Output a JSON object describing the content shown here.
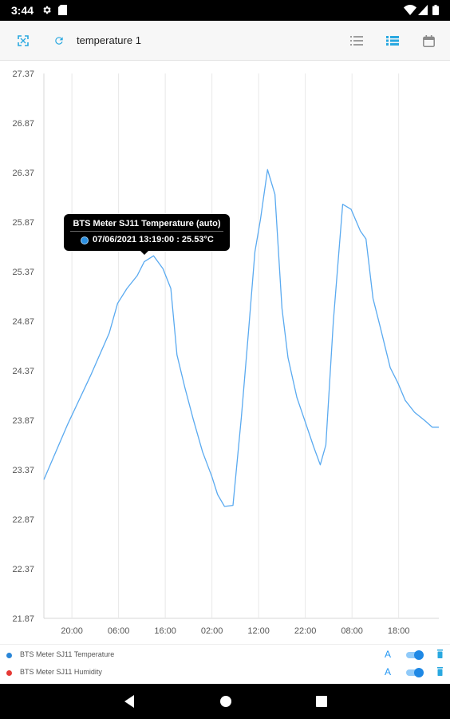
{
  "status_bar": {
    "time": "3:44",
    "icons": [
      "gear-icon",
      "sd-card-icon",
      "wifi-icon",
      "cell-signal-icon",
      "battery-icon"
    ]
  },
  "toolbar": {
    "title": "temperature 1",
    "icons": [
      "fullscreen-icon",
      "refresh-icon",
      "list-icon",
      "list-detail-icon",
      "calendar-icon"
    ],
    "accent": "#29a8e0"
  },
  "tooltip": {
    "title": "BTS Meter SJ11 Temperature (auto)",
    "value": "07/06/2021 13:19:00 : 25.53°C"
  },
  "chart_data": {
    "type": "line",
    "title": "",
    "xlabel": "",
    "ylabel": "",
    "y_ticks": [
      "27.37",
      "26.87",
      "26.37",
      "25.87",
      "25.37",
      "24.87",
      "24.37",
      "23.87",
      "23.37",
      "22.87",
      "22.37",
      "21.87"
    ],
    "ylim": [
      21.87,
      27.37
    ],
    "x_ticks": [
      "20:00",
      "06:00",
      "16:00",
      "02:00",
      "12:00",
      "22:00",
      "08:00",
      "18:00"
    ],
    "x_tick_hours": [
      6,
      16,
      26,
      36,
      46,
      56,
      66,
      76
    ],
    "xlim_hours": [
      0,
      84.6
    ],
    "grid": true,
    "series": [
      {
        "name": "BTS Meter SJ11 Temperature",
        "color": "#5aaaf0",
        "x_hours": [
          0,
          5,
          10,
          14,
          15.8,
          17.8,
          20,
          21.5,
          23.5,
          25.5,
          27.2,
          28.5,
          30.2,
          32,
          34,
          36,
          37.2,
          38.7,
          40.5,
          42.3,
          43.8,
          45.2,
          46.4,
          47.9,
          49.5,
          51,
          52.3,
          54.2,
          56,
          57.8,
          59.2,
          60.4,
          62,
          64,
          65.8,
          67.8,
          69,
          70.5,
          72.1,
          74.2,
          75.8,
          77.4,
          79.4,
          81.5,
          83.2,
          84.6
        ],
        "values": [
          23.27,
          23.82,
          24.32,
          24.75,
          25.05,
          25.2,
          25.33,
          25.47,
          25.53,
          25.4,
          25.2,
          24.53,
          24.2,
          23.88,
          23.55,
          23.3,
          23.12,
          23.0,
          23.01,
          23.9,
          24.75,
          25.57,
          25.9,
          26.4,
          26.15,
          25.0,
          24.5,
          24.1,
          23.85,
          23.6,
          23.42,
          23.62,
          24.87,
          26.05,
          26.0,
          25.78,
          25.7,
          25.1,
          24.8,
          24.4,
          24.25,
          24.07,
          23.95,
          23.87,
          23.8,
          23.8
        ]
      }
    ]
  },
  "legend": {
    "items": [
      {
        "label": "BTS Meter SJ11 Temperature",
        "color": "#2a86d8",
        "axis": "A",
        "enabled": true
      },
      {
        "label": "BTS Meter SJ11 Humidity",
        "color": "#e53935",
        "axis": "A",
        "enabled": true
      }
    ]
  },
  "nav_bar": {
    "icons": [
      "back-icon",
      "home-icon",
      "recents-icon"
    ]
  }
}
